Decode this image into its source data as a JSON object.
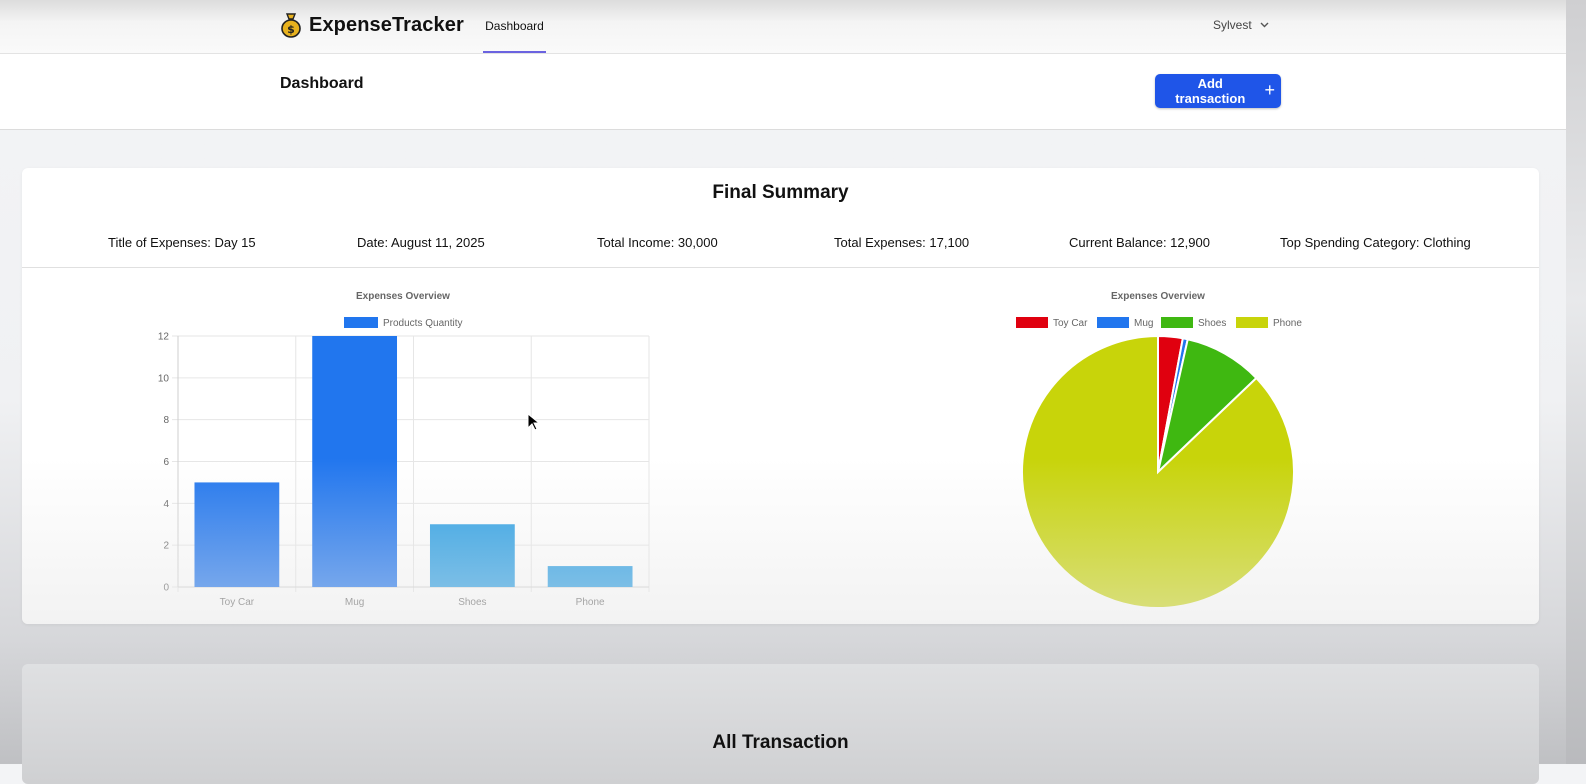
{
  "app": {
    "name": "ExpenseTracker"
  },
  "nav": {
    "active_tab": "Dashboard",
    "user": "Sylvest"
  },
  "header": {
    "title": "Dashboard",
    "add_button_label": "Add transaction"
  },
  "summary": {
    "title": "Final Summary",
    "stats": [
      "Title of Expenses: Day 15",
      "Date: August 11, 2025",
      "Total Income: 30,000",
      "Total Expenses: 17,100",
      "Current Balance: 12,900",
      "Top Spending Category: Clothing"
    ]
  },
  "colors": {
    "primary": "#1f55e8",
    "nav_active": "#6b63e0",
    "logo_gold": "#e8b21e"
  },
  "icons": {
    "logo": "money-bag-icon",
    "user_menu": "chevron-down-icon",
    "add": "plus-icon"
  },
  "chart_data": [
    {
      "type": "bar",
      "title": "Expenses Overview",
      "categories": [
        "Toy Car",
        "Mug",
        "Shoes",
        "Phone"
      ],
      "series": [
        {
          "name": "Products Quantity",
          "values": [
            5,
            12,
            3,
            1
          ]
        }
      ],
      "bar_colors": [
        "#2176ee",
        "#2176ee",
        "#2b9fe4",
        "#2b9fe4"
      ],
      "ylim": [
        0,
        12
      ],
      "yticks": [
        0,
        2,
        4,
        6,
        8,
        10,
        12
      ],
      "grid": true,
      "legend": "top"
    },
    {
      "type": "pie",
      "title": "Expenses Overview",
      "labels": [
        "Toy Car",
        "Mug",
        "Shoes",
        "Phone"
      ],
      "values": [
        500,
        100,
        1600,
        14900
      ],
      "colors": [
        "#e0000f",
        "#2176ee",
        "#3fb811",
        "#c8d40a"
      ],
      "legend": "top"
    }
  ],
  "transactions": {
    "title": "All Transaction"
  }
}
